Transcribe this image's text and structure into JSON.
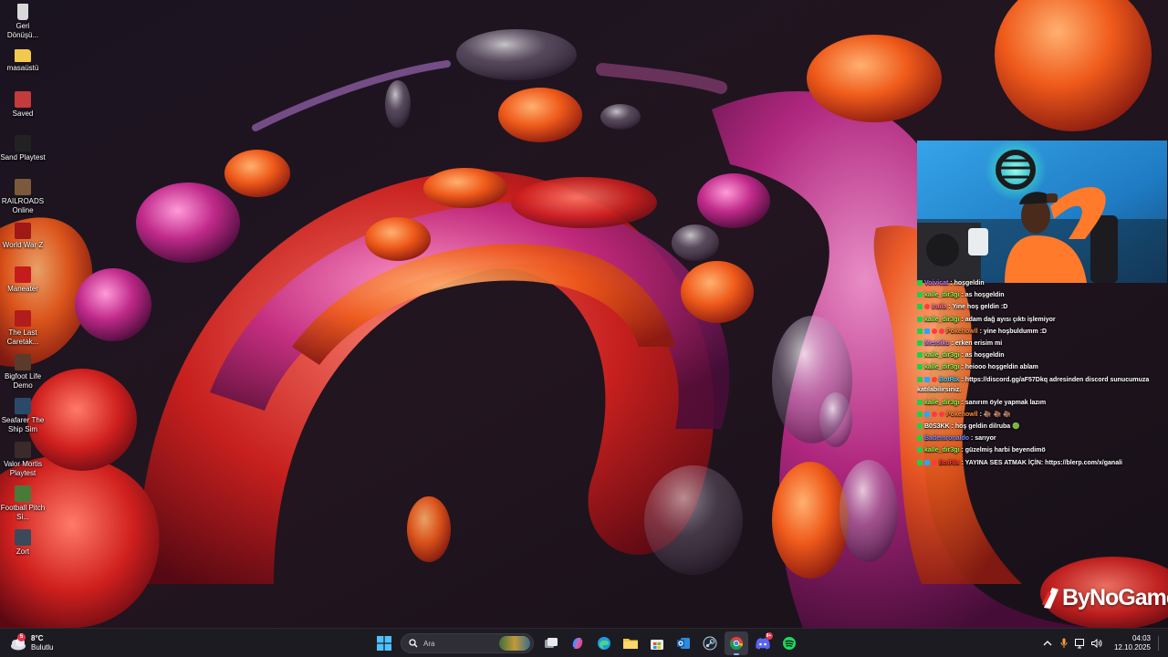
{
  "desktop_icons": [
    {
      "label": "Geri Dönüşü...",
      "icon": "recycle-bin-icon",
      "color": "#d8d8d8"
    },
    {
      "label": "masaüstü",
      "icon": "folder-icon",
      "color": "#f2c94c"
    },
    {
      "label": "Saved",
      "icon": "saved-game-icon",
      "color": "#c33b3b"
    },
    {
      "label": "Sand Playtest",
      "icon": "sand-game-icon",
      "color": "#222222"
    },
    {
      "label": "RAILROADS Online",
      "icon": "railroads-game-icon",
      "color": "#7a5a3a"
    },
    {
      "label": "World War Z",
      "icon": "wwz-game-icon",
      "color": "#a01818"
    },
    {
      "label": "Maneater",
      "icon": "maneater-game-icon",
      "color": "#c41c1c"
    },
    {
      "label": "The Last Caretak...",
      "icon": "caretaker-game-icon",
      "color": "#b21c1c"
    },
    {
      "label": "Bigfoot Life Demo",
      "icon": "bigfoot-game-icon",
      "color": "#5a3a2a"
    },
    {
      "label": "Seafarer The Ship Sim",
      "icon": "seafarer-game-icon",
      "color": "#2b4a6a"
    },
    {
      "label": "Valor Mortis Playtest",
      "icon": "valor-mortis-game-icon",
      "color": "#3a2a2a"
    },
    {
      "label": "Football Pitch Si...",
      "icon": "football-game-icon",
      "color": "#4a7a3a"
    },
    {
      "label": "Zort",
      "icon": "zort-game-icon",
      "color": "#3a4a5a"
    }
  ],
  "chat": {
    "messages": [
      {
        "badges": [
          "k"
        ],
        "user": "Voivicat",
        "user_color": "#c878ff",
        "text": "hoşgeldin"
      },
      {
        "badges": [
          "k"
        ],
        "user": "kalle_dir3gi",
        "user_color": "#8cff4a",
        "text": "as hoşgeldin"
      },
      {
        "badges": [
          "k",
          "sub"
        ],
        "user": "Iraila",
        "user_color": "#ff6b9a",
        "text": "Yine hoş geldin :D"
      },
      {
        "badges": [
          "k"
        ],
        "user": "kalle_dir3gi",
        "user_color": "#8cff4a",
        "text": "adam dağ ayısı çıktı işlemiyor"
      },
      {
        "badges": [
          "k",
          "mod",
          "sub",
          "sub"
        ],
        "user": "Pokehowll",
        "user_color": "#ff8c3a",
        "text": "yine hoşbuldumm :D"
      },
      {
        "badges": [
          "k"
        ],
        "user": "Messiko",
        "user_color": "#d07bff",
        "text": "erken erisim mi"
      },
      {
        "badges": [
          "k"
        ],
        "user": "kalle_dir3gi",
        "user_color": "#8cff4a",
        "text": "as hoşgeldin"
      },
      {
        "badges": [
          "k"
        ],
        "user": "kalle_dir3gi",
        "user_color": "#8cff4a",
        "text": "heiooo hoşgeldin ablam"
      },
      {
        "badges": [
          "k",
          "mod",
          "sub"
        ],
        "user": "BotRix",
        "user_color": "#4ad6ff",
        "text": "https://discord.gg/aF57Dkq adresinden discord sunucumuza katılabilirsiniz.",
        "wrap": true
      },
      {
        "badges": [
          "k"
        ],
        "user": "kalle_dir3gi",
        "user_color": "#8cff4a",
        "text": "sanırım öyle yapmak lazım"
      },
      {
        "badges": [
          "k",
          "mod",
          "sub",
          "sub"
        ],
        "user": "Pokehowll",
        "user_color": "#ff8c3a",
        "text": "🦣 🦣 🦣"
      },
      {
        "badges": [
          "k"
        ],
        "user": "B0S3KK",
        "user_color": "#ffffff",
        "text": "hoş geldin dilruba 🟢"
      },
      {
        "badges": [
          "k"
        ],
        "user": "Bademronaldo",
        "user_color": "#7a8cff",
        "text": "sarıyor"
      },
      {
        "badges": [
          "k"
        ],
        "user": "kalle_dir3gi",
        "user_color": "#8cff4a",
        "text": "güzelmiş harbi beyendimö"
      },
      {
        "badges": [
          "k",
          "mod",
          "sub"
        ],
        "user": "BotRix",
        "user_color": "#ff3b3b",
        "text": "YAYINA SES ATMAK İÇİN: https://blerp.com/x/ganali"
      }
    ]
  },
  "watermark": {
    "text": "ByNoGame"
  },
  "taskbar": {
    "weather": {
      "temp": "8°C",
      "condition": "Bulutlu",
      "alert": "5"
    },
    "search": {
      "placeholder": "Ara"
    },
    "pinned": [
      {
        "name": "start",
        "icon": "windows-start-icon"
      },
      {
        "name": "task-view",
        "icon": "task-view-icon"
      },
      {
        "name": "copilot",
        "icon": "copilot-icon"
      },
      {
        "name": "edge",
        "icon": "edge-browser-icon"
      },
      {
        "name": "file-explorer",
        "icon": "folder-icon"
      },
      {
        "name": "store",
        "icon": "store-icon"
      },
      {
        "name": "outlook",
        "icon": "outlook-icon"
      },
      {
        "name": "steam",
        "icon": "steam-icon"
      },
      {
        "name": "chrome",
        "icon": "chrome-icon"
      },
      {
        "name": "discord",
        "icon": "discord-icon",
        "badge": "9+"
      },
      {
        "name": "spotify",
        "icon": "spotify-icon"
      }
    ],
    "tray": {
      "time": "04:03",
      "date": "12.10.2025"
    }
  }
}
